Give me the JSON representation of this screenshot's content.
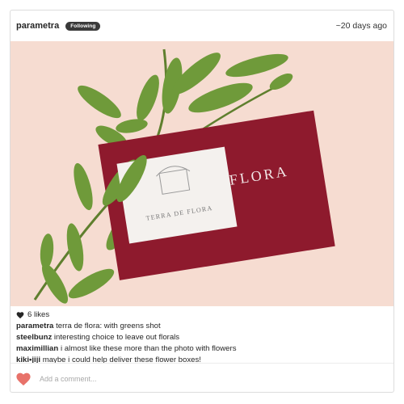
{
  "post": {
    "author": "parametra",
    "follow_badge": "Following",
    "time": "~20 days ago"
  },
  "photo": {
    "envelope_text": "E FLORA",
    "card_text": "TERRA DE FLORA",
    "colors": {
      "background": "#f6dcd1",
      "envelope": "#8e1a2d",
      "card": "#f4f1ee",
      "leaf": "#6f9a3a"
    }
  },
  "likes": {
    "icon": "heart-icon",
    "label": "6 likes"
  },
  "comments": [
    {
      "user": "parametra",
      "text": "terra de flora: with greens shot"
    },
    {
      "user": "steelbunz",
      "text": "interesting choice to leave out florals"
    },
    {
      "user": "maximillian",
      "text": "i almost like these more than the photo with flowers"
    },
    {
      "user": "kiki•jiji",
      "text": "maybe i could help deliver these flower boxes!"
    }
  ],
  "add_comment": {
    "placeholder": "Add a comment...",
    "like_color": "#e8726a"
  }
}
